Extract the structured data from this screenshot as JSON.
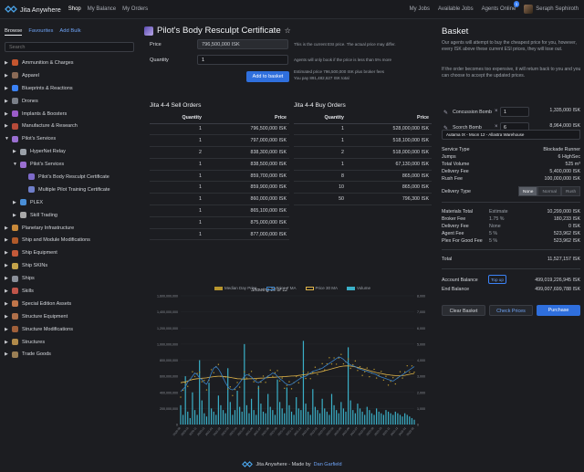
{
  "app": {
    "name": "Jita Anywhere"
  },
  "nav": {
    "shop": "Shop",
    "balance": "My Balance",
    "orders": "My Orders"
  },
  "nav_right": {
    "jobs": "My Jobs",
    "available": "Available Jobs",
    "agents": "Agents Online",
    "agents_badge": "1",
    "user": "Seraph Sephiroth"
  },
  "sidebar": {
    "tabs": [
      "Browse",
      "Favourites",
      "Add Bulk"
    ],
    "search_placeholder": "Search",
    "items": [
      {
        "label": "Ammunition & Charges",
        "arrow": "▶",
        "indent": 0,
        "color": "#c4562f"
      },
      {
        "label": "Apparel",
        "arrow": "▶",
        "indent": 0,
        "color": "#8a6a56"
      },
      {
        "label": "Blueprints & Reactions",
        "arrow": "▶",
        "indent": 0,
        "color": "#3b82f6"
      },
      {
        "label": "Drones",
        "arrow": "▶",
        "indent": 0,
        "color": "#7a7f88"
      },
      {
        "label": "Implants & Boosters",
        "arrow": "▶",
        "indent": 0,
        "color": "#9b5cc9"
      },
      {
        "label": "Manufacture & Research",
        "arrow": "▶",
        "indent": 0,
        "color": "#b74b3a"
      },
      {
        "label": "Pilot's Services",
        "arrow": "▼",
        "indent": 0,
        "color": "#9a6fd1"
      },
      {
        "label": "HyperNet Relay",
        "arrow": "▶",
        "indent": 1,
        "color": "#9aa0a8"
      },
      {
        "label": "Pilot's Services",
        "arrow": "▼",
        "indent": 1,
        "color": "#9a6fd1"
      },
      {
        "label": "Pilot's Body Resculpt Certificate",
        "arrow": "",
        "indent": 2,
        "color": "#7d6ac9"
      },
      {
        "label": "Multiple Pilot Training Certificate",
        "arrow": "",
        "indent": 2,
        "color": "#6f7ec9"
      },
      {
        "label": "PLEX",
        "arrow": "▶",
        "indent": 1,
        "color": "#4a8fd8"
      },
      {
        "label": "Skill Trading",
        "arrow": "▶",
        "indent": 1,
        "color": "#a8a8a8"
      },
      {
        "label": "Planetary Infrastructure",
        "arrow": "▶",
        "indent": 0,
        "color": "#c98a3a"
      },
      {
        "label": "Ship and Module Modifications",
        "arrow": "▶",
        "indent": 0,
        "color": "#b05a2a"
      },
      {
        "label": "Ship Equipment",
        "arrow": "▶",
        "indent": 0,
        "color": "#c45a3a"
      },
      {
        "label": "Ship SKINs",
        "arrow": "▶",
        "indent": 0,
        "color": "#c4a34a"
      },
      {
        "label": "Ships",
        "arrow": "▶",
        "indent": 0,
        "color": "#8a8f98"
      },
      {
        "label": "Skills",
        "arrow": "▶",
        "indent": 0,
        "color": "#c0554a"
      },
      {
        "label": "Special Edition Assets",
        "arrow": "▶",
        "indent": 0,
        "color": "#c0754a"
      },
      {
        "label": "Structure Equipment",
        "arrow": "▶",
        "indent": 0,
        "color": "#b0704a"
      },
      {
        "label": "Structure Modifications",
        "arrow": "▶",
        "indent": 0,
        "color": "#a0603a"
      },
      {
        "label": "Structures",
        "arrow": "▶",
        "indent": 0,
        "color": "#b08a4a"
      },
      {
        "label": "Trade Goods",
        "arrow": "▶",
        "indent": 0,
        "color": "#9a7f55"
      }
    ]
  },
  "product": {
    "title": "Pilot's Body Resculpt Certificate",
    "price_label": "Price",
    "price_value": "796,500,000 ISK",
    "price_note": "This is the current ESI price. The actual price may differ.",
    "qty_label": "Quantity",
    "qty_value": "1",
    "qty_note": "Agents will only book if the price is less than 5% more",
    "estimate_line1": "Estimated price 796,500,000 ISK plus broker fees",
    "estimate_line2": "You pay 891,482,627 ISK total",
    "add_button": "Add to basket"
  },
  "sell_orders": {
    "title": "Jita 4-4 Sell Orders",
    "headers": [
      "Quantity",
      "Price"
    ],
    "rows": [
      [
        "1",
        "796,500,000 ISK"
      ],
      [
        "1",
        "797,000,000 ISK"
      ],
      [
        "2",
        "838,300,000 ISK"
      ],
      [
        "1",
        "838,500,000 ISK"
      ],
      [
        "1",
        "859,700,000 ISK"
      ],
      [
        "1",
        "859,900,000 ISK"
      ],
      [
        "1",
        "860,000,000 ISK"
      ],
      [
        "1",
        "865,100,000 ISK"
      ],
      [
        "1",
        "875,000,000 ISK"
      ],
      [
        "1",
        "877,000,000 ISK"
      ]
    ],
    "showing": "Showing 10 of 12"
  },
  "buy_orders": {
    "title": "Jita 4-4 Buy Orders",
    "headers": [
      "Quantity",
      "Price"
    ],
    "rows": [
      [
        "1",
        "528,000,000 ISK"
      ],
      [
        "1",
        "518,100,000 ISK"
      ],
      [
        "2",
        "518,000,000 ISK"
      ],
      [
        "1",
        "67,130,000 ISK"
      ],
      [
        "8",
        "865,000 ISK"
      ],
      [
        "10",
        "865,000 ISK"
      ],
      [
        "50",
        "796,300 ISK"
      ]
    ]
  },
  "chart_data": {
    "type": "line",
    "series": [
      {
        "name": "Median Day Price",
        "color": "#b8962e"
      },
      {
        "name": "Price 7 MA",
        "color": "#3b82c6"
      },
      {
        "name": "Price 30 MA",
        "color": "#e0b54a"
      },
      {
        "name": "Volume",
        "color": "#3ab0c8"
      }
    ],
    "yleft_ticks": [
      "1,600,000,000",
      "1,400,000,000",
      "1,200,000,000",
      "1,000,000,000",
      "800,000,000",
      "600,000,000",
      "400,000,000",
      "200,000,000",
      "0"
    ],
    "yright_ticks": [
      "8,000",
      "7,000",
      "6,000",
      "5,000",
      "4,000",
      "3,000",
      "2,000",
      "1,000",
      "0"
    ],
    "price_7ma": [
      410,
      440,
      470,
      530,
      560,
      600,
      640,
      620,
      580,
      560,
      520,
      500,
      560,
      640,
      700,
      720,
      690,
      640,
      580,
      520,
      470,
      440,
      430,
      450,
      480,
      520,
      560,
      600,
      620,
      610,
      590,
      560,
      530,
      520,
      540,
      560,
      580,
      600,
      620,
      640,
      630,
      600,
      570,
      550,
      520,
      500,
      490,
      500,
      520,
      540,
      560,
      580,
      590,
      600,
      620,
      640,
      660,
      670,
      680,
      690,
      700,
      720,
      740,
      760,
      780,
      800,
      820,
      840,
      830,
      810,
      780,
      760,
      740,
      730,
      720,
      700,
      690,
      680,
      670,
      660,
      650,
      640,
      630,
      620,
      600,
      590,
      580,
      570,
      560,
      550,
      540,
      560,
      580,
      600,
      620,
      640,
      660,
      680,
      700,
      720
    ],
    "price_30ma": [
      520,
      525,
      530,
      540,
      550,
      560,
      565,
      570,
      572,
      575,
      578,
      580,
      585,
      590,
      595,
      598,
      600,
      600,
      598,
      595,
      590,
      585,
      580,
      575,
      570,
      568,
      566,
      565,
      566,
      568,
      570,
      572,
      574,
      575,
      576,
      578,
      580,
      582,
      584,
      586,
      588,
      590,
      592,
      594,
      596,
      598,
      600,
      602,
      604,
      606,
      610,
      614,
      618,
      622,
      626,
      630,
      636,
      642,
      648,
      654,
      660,
      668,
      676,
      684,
      692,
      700,
      708,
      716,
      722,
      726,
      728,
      728,
      726,
      722,
      716,
      710,
      702,
      694,
      686,
      678,
      670,
      662,
      654,
      646,
      640,
      634,
      628,
      622,
      618,
      614,
      610,
      608,
      606,
      606,
      608,
      612,
      618,
      624,
      630,
      636
    ],
    "volume": [
      120,
      60,
      300,
      80,
      40,
      200,
      90,
      60,
      400,
      150,
      70,
      50,
      260,
      100,
      80,
      60,
      180,
      120,
      90,
      70,
      350,
      140,
      60,
      90,
      210,
      110,
      80,
      500,
      120,
      70,
      160,
      90,
      60,
      240,
      130,
      80,
      70,
      190,
      110,
      90,
      60,
      280,
      140,
      100,
      70,
      230,
      120,
      80,
      60,
      170,
      100,
      90,
      520,
      130,
      80,
      60,
      220,
      110,
      90,
      70,
      160,
      100,
      80,
      60,
      190,
      120,
      90,
      70,
      140,
      100,
      80,
      480,
      150,
      90,
      70,
      130,
      100,
      80,
      60,
      110,
      90,
      70,
      60,
      100,
      80,
      70,
      60,
      90,
      80,
      70,
      60,
      80,
      70,
      60,
      50,
      70,
      60,
      50,
      40,
      30
    ],
    "xlabels": [
      "2020-09",
      "2020-10",
      "2020-11",
      "2020-12",
      "2021-01",
      "2021-02",
      "2021-03",
      "2021-04",
      "2021-05",
      "2021-06",
      "2021-07",
      "2021-08",
      "2021-09",
      "2021-10",
      "2021-11",
      "2021-12",
      "2022-01",
      "2022-02",
      "2022-03",
      "2022-04",
      "2022-05",
      "2022-06",
      "2022-07",
      "2022-08",
      "2022-09",
      "2022-10",
      "2022-11",
      "2022-12",
      "2023-01",
      "2023-02"
    ]
  },
  "basket": {
    "title": "Basket",
    "text1": "Our agents will attempt to buy the cheapest price for you, however, every ISK above these current ESI prices, they will lose out.",
    "text2": "If the order becomes too expensive, it will return back to you and you can choose to accept the updated prices.",
    "items": [
      {
        "name": "Concussion Bomb",
        "qty": "1",
        "unit": "1,335,000 ISK",
        "total": ""
      },
      {
        "name": "Scorch Bomb",
        "qty": "6",
        "unit": "8,964,000 ISK",
        "total": "1,494,000 ISK"
      }
    ],
    "location": "Autama IX - Moon 12 - Allastra Warehouse",
    "service_type_label": "Service Type",
    "service_type": "Blockade Runner",
    "jumps_label": "Jumps",
    "jumps": "6 HighSec",
    "volume_label": "Total Volume",
    "volume": "525 m³",
    "delivery_fee_label": "Delivery Fee",
    "delivery_fee": "5,400,000 ISK",
    "rush_fee_label": "Rush Fee",
    "rush_fee": "100,000,000 ISK",
    "delivery_type_label": "Delivery Type",
    "delivery_types": [
      "None",
      "Normal",
      "Rush"
    ],
    "materials_label": "Materials Total",
    "materials_mid": "Estimate",
    "materials": "10,299,000 ISK",
    "broker_label": "Broker Fee",
    "broker_mid": "1.75 %",
    "broker": "180,233 ISK",
    "delivery_label": "Delivery Fee",
    "delivery_mid": "None",
    "delivery": "0 ISK",
    "agent_label": "Agent Fee",
    "agent_mid": "5 %",
    "agent": "523,962 ISK",
    "plex_label": "Plex For Good Fee",
    "plex_mid": "5 %",
    "plex": "523,962 ISK",
    "total_label": "Total",
    "total": "11,527,157 ISK",
    "account_label": "Account Balance",
    "topup": "Top up",
    "account": "499,019,226,945 ISK",
    "end_label": "End Balance",
    "end": "499,007,699,788 ISK",
    "clear": "Clear Basket",
    "check": "Check Prices",
    "purchase": "Purchase"
  },
  "footer": {
    "text": "Jita Anywhere - Made by",
    "author": "Dan Garfield"
  }
}
